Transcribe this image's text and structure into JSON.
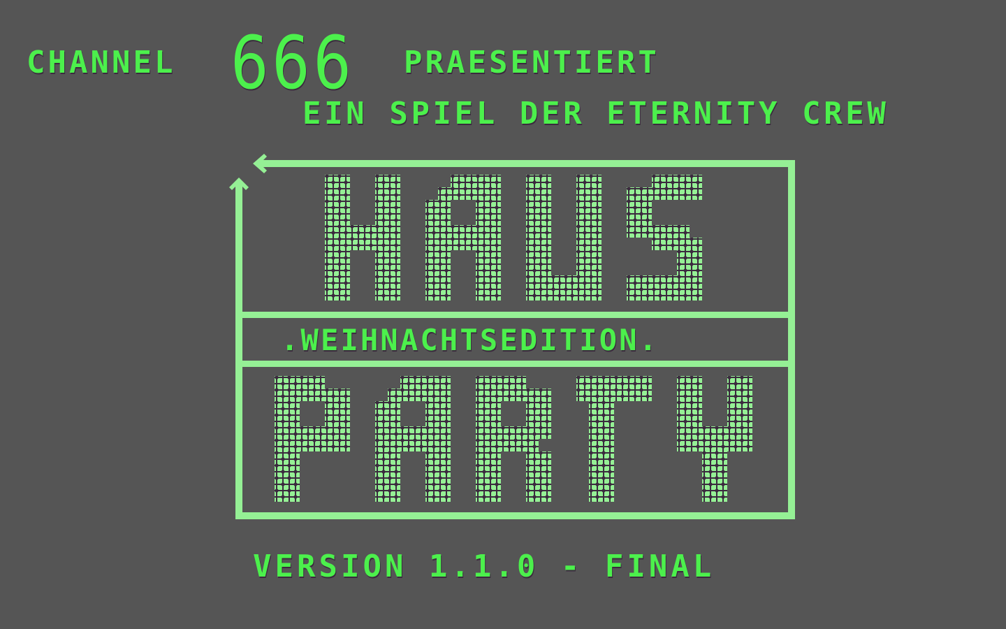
{
  "screen": "title-screen",
  "header": {
    "channel_label": "CHANNEL",
    "channel_number": "666",
    "presents_label": "PRAESENTIERT",
    "credit_line": "EIN SPIEL DER ETERNITY CREW"
  },
  "logo": {
    "word_top": "HAUS",
    "subtitle": ".WEIHNACHTSEDITION.",
    "word_bottom": "PARTY"
  },
  "footer": {
    "version": "VERSION 1.1.0 - FINAL"
  },
  "colors": {
    "background": "#555555",
    "text_green": "#4cf04c",
    "logo_green": "#95f095",
    "shadow": "#3b2a3e"
  }
}
